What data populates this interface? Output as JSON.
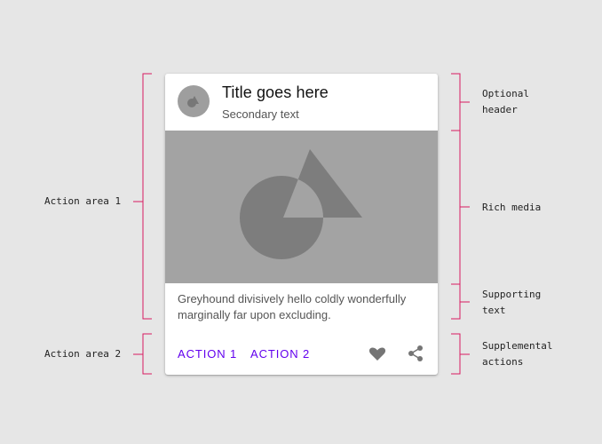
{
  "card": {
    "title": "Title goes here",
    "subtitle": "Secondary text",
    "supporting_text": "Greyhound divisively hello coldly wonderfully marginally far upon excluding.",
    "actions": [
      "ACTION 1",
      "ACTION 2"
    ],
    "icons": [
      "heart-icon",
      "share-icon"
    ],
    "accent_color": "#6200ee"
  },
  "annotations": {
    "left": [
      "Action area 1",
      "Action area 2"
    ],
    "right": {
      "optional_header": [
        "Optional",
        "header"
      ],
      "rich_media": "Rich media",
      "supporting_text": [
        "Supporting",
        "text"
      ],
      "supplemental_actions": [
        "Supplemental",
        "actions"
      ]
    },
    "bracket_color": "#d81b60"
  }
}
